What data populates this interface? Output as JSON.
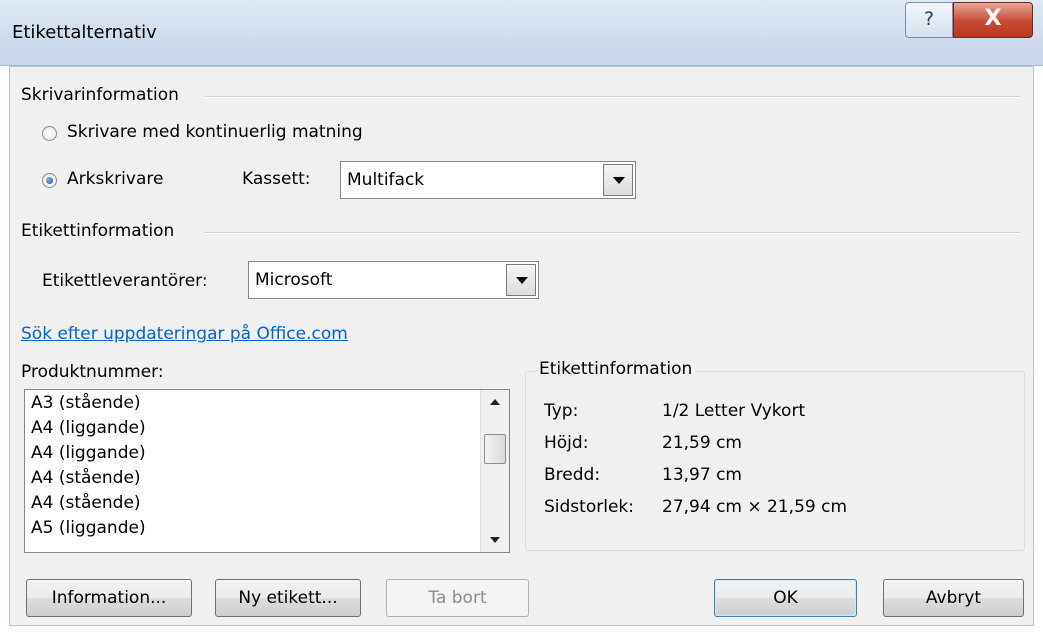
{
  "window": {
    "title": "Etikettalternativ",
    "help_glyph": "?",
    "close_glyph": "X"
  },
  "printer_info": {
    "heading": "Skrivarinformation",
    "option_continuous": "Skrivare med kontinuerlig matning",
    "option_sheet": "Arkskrivare",
    "selected": "sheet",
    "tray_label": "Kassett:",
    "tray_value": "Multifack"
  },
  "label_info": {
    "heading": "Etikettinformation",
    "vendor_label": "Etikettleverantörer:",
    "vendor_value": "Microsoft",
    "update_link": "Sök efter uppdateringar på Office.com"
  },
  "products": {
    "heading": "Produktnummer:",
    "items": [
      "A3 (stående)",
      "A4 (liggande)",
      "A4 (liggande)",
      "A4 (stående)",
      "A4 (stående)",
      "A5 (liggande)"
    ]
  },
  "details": {
    "heading": "Etikettinformation",
    "rows": [
      {
        "key": "Typ:",
        "value": "1/2 Letter Vykort"
      },
      {
        "key": "Höjd:",
        "value": "21,59 cm"
      },
      {
        "key": "Bredd:",
        "value": "13,97 cm"
      },
      {
        "key": "Sidstorlek:",
        "value": "27,94 cm × 21,59 cm"
      }
    ]
  },
  "buttons": {
    "information": "Information...",
    "new_label": "Ny etikett...",
    "delete": "Ta bort",
    "ok": "OK",
    "cancel": "Avbryt"
  },
  "colors": {
    "link": "#0066cc",
    "close_button": "#c74a32",
    "dialog_background": "#f0f0f0"
  }
}
